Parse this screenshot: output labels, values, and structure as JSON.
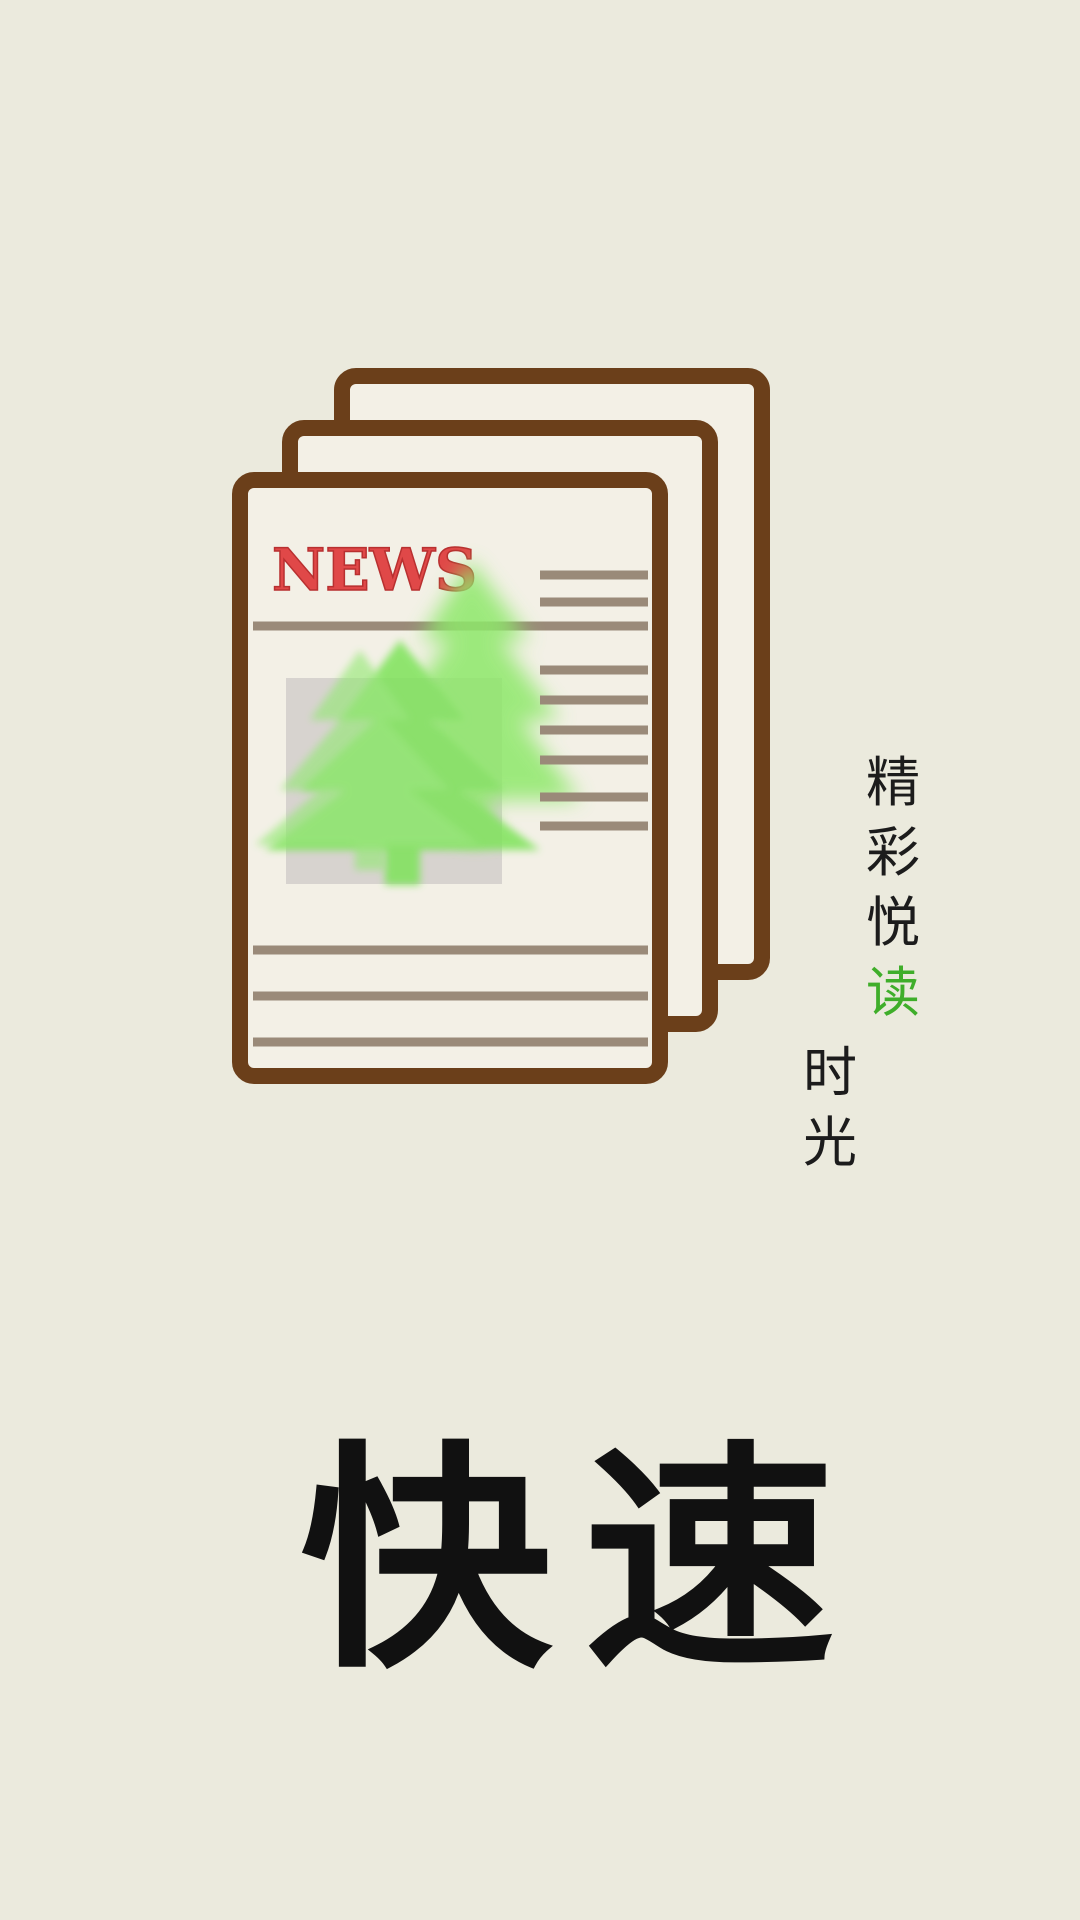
{
  "logo": {
    "masthead": "NEWS",
    "icon": "newspaper-stack-icon",
    "colors": {
      "frame": "#6b3f1a",
      "paper": "#f3f0e6",
      "rule": "#9a8a79",
      "masthead": "#e04848",
      "tree": "#7ee35a",
      "photo": "#d7d3cf"
    }
  },
  "tagline": {
    "chars": [
      "精",
      "彩",
      "悦"
    ],
    "highlight": "读",
    "sub": [
      "时",
      "光"
    ],
    "highlight_color": "#3fae2a"
  },
  "brand": {
    "name": "快速"
  },
  "background": "#ebeadd"
}
